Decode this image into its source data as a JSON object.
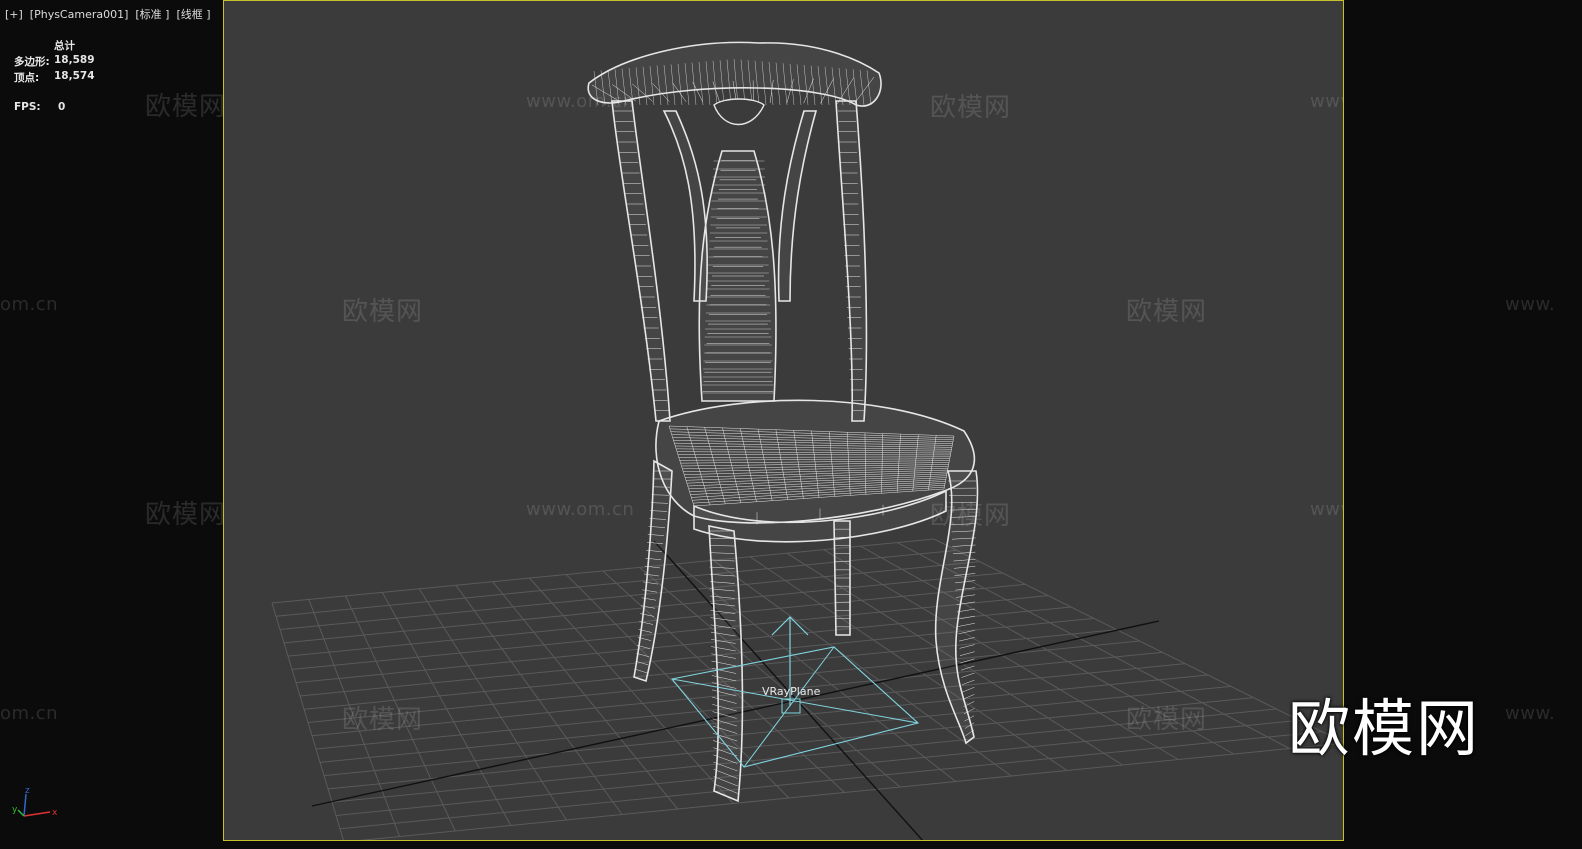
{
  "viewport": {
    "label": "[+]  [PhysCamera001]  [标准 ]  [线框 ]"
  },
  "stats": {
    "header": "总计",
    "polygons_label": "多边形:",
    "polygons_value": "18,589",
    "vertices_label": "顶点:",
    "vertices_value": "18,574",
    "fps_label": "FPS:",
    "fps_value": "0"
  },
  "scene": {
    "object_label": "VRayPlane",
    "wireframe_color": "#e6e6e6",
    "light_color": "#7fd4de",
    "grid_color": "#5a5a5a"
  },
  "watermarks": {
    "cn": "欧模网",
    "url": "www.om.cn",
    "url_partial_left": "om.cn",
    "url_partial_right": "www."
  },
  "logo": {
    "text": "欧模网"
  },
  "axis_gizmo": {
    "x": "x",
    "y": "y",
    "z": "z"
  }
}
